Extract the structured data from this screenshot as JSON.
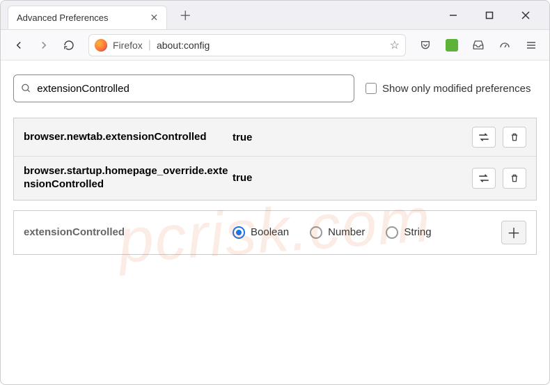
{
  "tab": {
    "title": "Advanced Preferences"
  },
  "urlbar": {
    "label": "Firefox",
    "path": "about:config"
  },
  "search": {
    "value": "extensionControlled",
    "modified_label": "Show only modified preferences"
  },
  "prefs": [
    {
      "name": "browser.newtab.extensionControlled",
      "value": "true"
    },
    {
      "name": "browser.startup.homepage_override.extensionControlled",
      "value": "true"
    }
  ],
  "new_pref": {
    "name": "extensionControlled",
    "types": {
      "boolean": "Boolean",
      "number": "Number",
      "string": "String"
    }
  },
  "watermark": "pcrisk.com"
}
